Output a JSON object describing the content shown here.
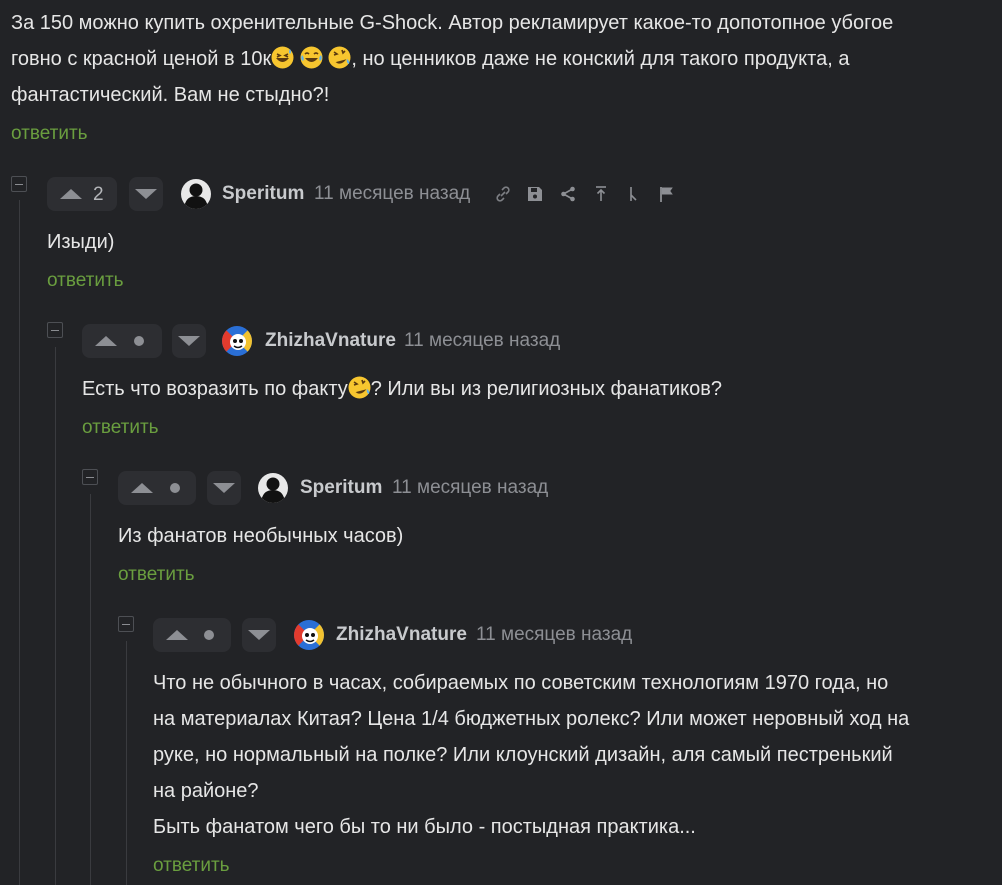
{
  "parent_comment": {
    "line1": "За 150 можно купить охренительные G-Shock. Автор рекламирует какое-то допотопное убогое",
    "line2_a": "говно с красной ценой в 10к",
    "line2_b": ", но ценников даже не конский для такого продукта, а",
    "line3": "фантастический. Вам не стыдно?!",
    "reply": "ответить"
  },
  "comments": [
    {
      "votes": "2",
      "username": "Speritum",
      "time": "11 месяцев назад",
      "text": "Изыди)",
      "reply": "ответить",
      "tools": [
        "link-icon",
        "save-icon",
        "share-icon",
        "parent-icon",
        "branch-icon",
        "flag-icon"
      ]
    },
    {
      "username": "ZhizhaVnature",
      "time": "11 месяцев назад",
      "text_a": "Есть что возразить по факту",
      "text_b": "? Или вы из религиозных фанатиков?",
      "reply": "ответить"
    },
    {
      "username": "Speritum",
      "time": "11 месяцев назад",
      "text": "Из фанатов необычных часов)",
      "reply": "ответить"
    },
    {
      "username": "ZhizhaVnature",
      "time": "11 месяцев назад",
      "lines": [
        "Что не обычного в часах, собираемых по советским технологиям 1970 года, но",
        "на материалах Китая? Цена 1/4 бюджетных ролекс? Или может неровный ход на",
        "руке, но нормальный на полке? Или клоунский дизайн, аля самый пестренький",
        "на районе?",
        "Быть фанатом чего бы то ни было - постыдная практика..."
      ],
      "reply": "ответить"
    }
  ],
  "colors": {
    "background": "#222326",
    "reply_link": "#6a9e3f",
    "text": "#e6e6e6",
    "meta": "#8d8f94"
  }
}
